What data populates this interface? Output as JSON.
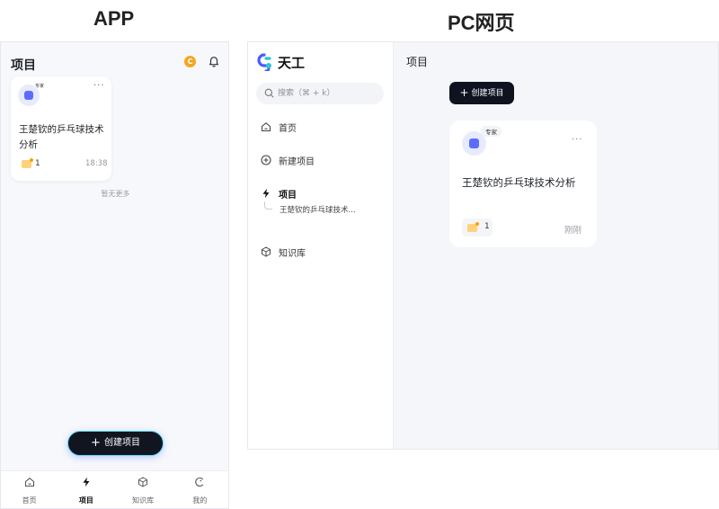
{
  "headings": {
    "app": "APP",
    "pc": "PC网页"
  },
  "colors": {
    "accent": "#5b6cff",
    "dark_button": "#11151f",
    "coin": "#f5a623",
    "background": "#f5f6f9"
  },
  "app": {
    "title": "项目",
    "coin_label": "C",
    "card": {
      "badge": "专家",
      "title": "王楚钦的乒乓球技术分析",
      "doc_count": "1",
      "time": "18:38",
      "more": "···"
    },
    "no_more": "暂无更多",
    "create_button": {
      "plus": "+",
      "label": "创建项目"
    },
    "tabs": [
      {
        "label": "首页",
        "icon": "home-icon"
      },
      {
        "label": "项目",
        "icon": "bolt-icon",
        "active": true
      },
      {
        "label": "知识库",
        "icon": "cube-icon"
      },
      {
        "label": "我的",
        "icon": "profile-icon"
      }
    ]
  },
  "pc": {
    "brand": "天工",
    "search": {
      "placeholder": "搜索（⌘ + k）"
    },
    "nav": {
      "home": "首页",
      "new_project": "新建项目",
      "projects": "项目",
      "project_child": "王楚钦的乒乓球技术...",
      "knowledge_base": "知识库"
    },
    "main_title": "项目",
    "create_button": {
      "plus": "+",
      "label": "创建项目"
    },
    "card": {
      "badge": "专家",
      "title": "王楚钦的乒乓球技术分析",
      "doc_count": "1",
      "time": "刚刚",
      "more": "···"
    }
  }
}
